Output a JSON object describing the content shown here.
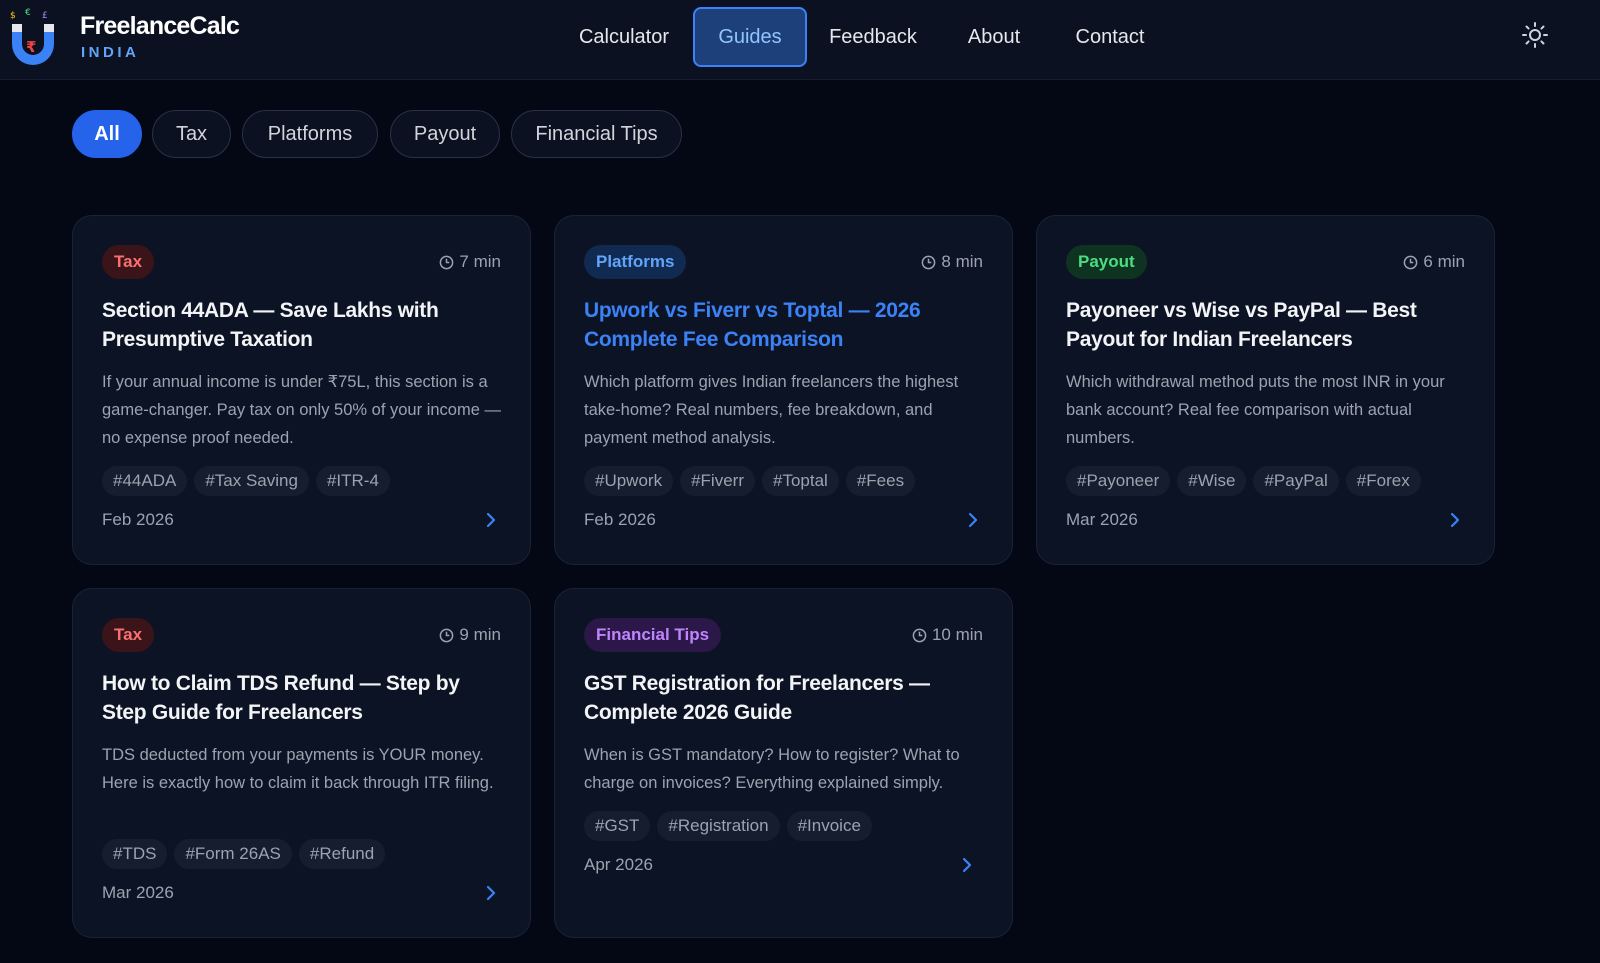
{
  "brand": {
    "name": "FreelanceCalc",
    "subtitle": "INDIA",
    "accent": "#60a5fa"
  },
  "nav": {
    "items": [
      {
        "label": "Calculator",
        "active": false
      },
      {
        "label": "Guides",
        "active": true
      },
      {
        "label": "Feedback",
        "active": false
      },
      {
        "label": "About",
        "active": false
      },
      {
        "label": "Contact",
        "active": false
      }
    ],
    "theme_icon": "sun-icon"
  },
  "filters": {
    "items": [
      "All",
      "Tax",
      "Platforms",
      "Payout",
      "Financial Tips"
    ],
    "selected": "All"
  },
  "colors": {
    "tax": "#f87171",
    "platforms": "#60a5fa",
    "payout": "#4ade80",
    "financial_tips": "#c084fc"
  },
  "guides": [
    {
      "category": "Tax",
      "read_time": "7 min",
      "title": "Section 44ADA — Save Lakhs with Presumptive Taxation",
      "description": "If your annual income is under ₹75L, this section is a game-changer. Pay tax on only 50% of your income — no expense proof needed.",
      "tags": [
        "#44ADA",
        "#Tax Saving",
        "#ITR-4"
      ],
      "date": "Feb 2026"
    },
    {
      "category": "Platforms",
      "read_time": "8 min",
      "title": "Upwork vs Fiverr vs Toptal — 2026 Complete Fee Comparison",
      "description": "Which platform gives Indian freelancers the highest take-home? Real numbers, fee breakdown, and payment method analysis.",
      "tags": [
        "#Upwork",
        "#Fiverr",
        "#Toptal",
        "#Fees"
      ],
      "date": "Feb 2026"
    },
    {
      "category": "Payout",
      "read_time": "6 min",
      "title": "Payoneer vs Wise vs PayPal — Best Payout for Indian Freelancers",
      "description": "Which withdrawal method puts the most INR in your bank account? Real fee comparison with actual numbers.",
      "tags": [
        "#Payoneer",
        "#Wise",
        "#PayPal",
        "#Forex"
      ],
      "date": "Mar 2026"
    },
    {
      "category": "Tax",
      "read_time": "9 min",
      "title": "How to Claim TDS Refund — Step by Step Guide for Freelancers",
      "description": "TDS deducted from your payments is YOUR money. Here is exactly how to claim it back through ITR filing.",
      "tags": [
        "#TDS",
        "#Form 26AS",
        "#Refund"
      ],
      "date": "Mar 2026"
    },
    {
      "category": "Financial Tips",
      "read_time": "10 min",
      "title": "GST Registration for Freelancers — Complete 2026 Guide",
      "description": "When is GST mandatory? How to register? What to charge on invoices? Everything explained simply.",
      "tags": [
        "#GST",
        "#Registration",
        "#Invoice"
      ],
      "date": "Apr 2026"
    }
  ]
}
